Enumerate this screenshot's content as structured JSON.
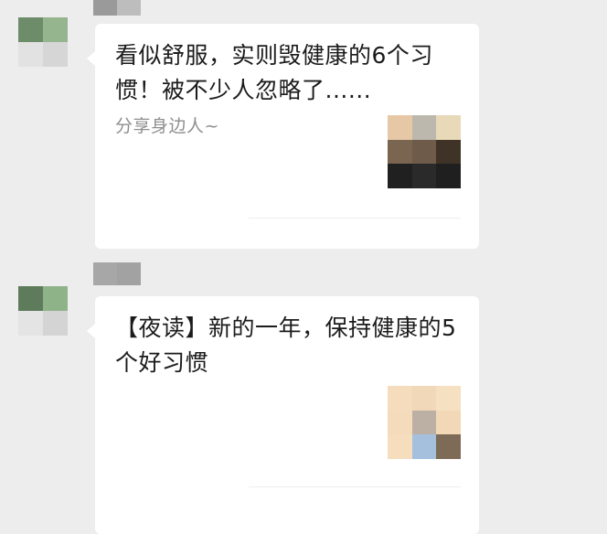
{
  "chat": {
    "messages": [
      {
        "type": "link-card",
        "title": "看似舒服，实则毁健康的6个习惯！被不少人忽略了......",
        "description": "分享身边人~",
        "sender_avatar_colors": [
          "#6d8c6a",
          "#94b58e",
          "#e2e2e2",
          "#d6d6d6"
        ],
        "sender_name_colors": [
          "#9a9a9a",
          "#bdbdbd"
        ],
        "thumbnail_colors": [
          "#e6c8a6",
          "#bcb8ae",
          "#e8d9b8",
          "#7a6550",
          "#6e5b4a",
          "#3e3326",
          "#202020",
          "#2a2a2a",
          "#1f1f1f"
        ]
      },
      {
        "type": "link-card",
        "title": "【夜读】新的一年，保持健康的5个好习惯",
        "description": "",
        "sender_avatar_colors": [
          "#5e7c5c",
          "#8fb389",
          "#e4e4e4",
          "#d4d4d4"
        ],
        "sender_name_colors": [
          "#a7a7a7",
          "#a2a2a2",
          "#d2d2d2"
        ],
        "thumbnail_colors": [
          "#f4dcbc",
          "#f1d8b8",
          "#f6e0c2",
          "#f3dbbb",
          "#bcb0a4",
          "#f2d8b6",
          "#f5ddbe",
          "#a4c0dc",
          "#7d6b58"
        ]
      }
    ]
  }
}
